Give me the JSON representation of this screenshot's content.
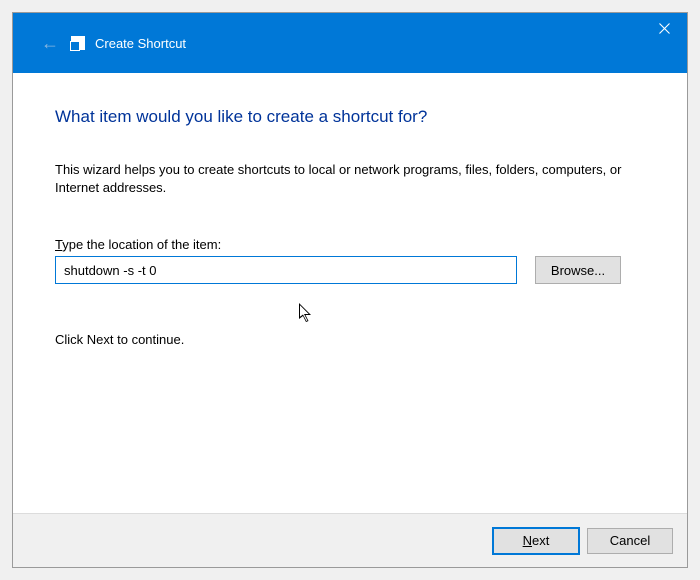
{
  "titlebar": {
    "title": "Create Shortcut"
  },
  "content": {
    "heading": "What item would you like to create a shortcut for?",
    "description": "This wizard helps you to create shortcuts to local or network programs, files, folders, computers, or Internet addresses.",
    "field_label_prefix": "T",
    "field_label_rest": "ype the location of the item:",
    "location_value": "shutdown -s -t 0",
    "browse_label": "Browse...",
    "continue_text": "Click Next to continue."
  },
  "footer": {
    "next_prefix": "N",
    "next_rest": "ext",
    "cancel_label": "Cancel"
  }
}
